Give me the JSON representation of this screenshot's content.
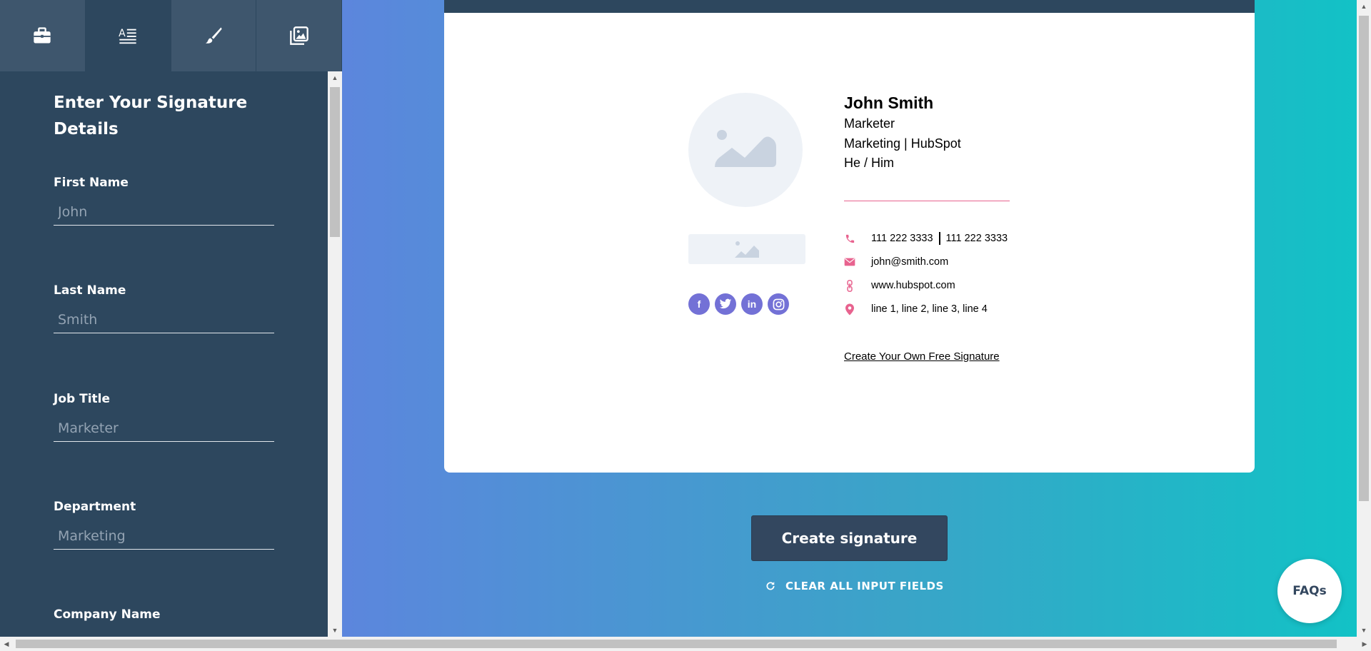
{
  "sidebar": {
    "tabs": [
      {
        "icon": "briefcase-icon"
      },
      {
        "icon": "text-format-icon"
      },
      {
        "icon": "brush-icon"
      },
      {
        "icon": "image-gallery-icon"
      }
    ],
    "form_title": "Enter Your Signature Details",
    "fields": [
      {
        "label": "First Name",
        "placeholder": "John"
      },
      {
        "label": "Last Name",
        "placeholder": "Smith"
      },
      {
        "label": "Job Title",
        "placeholder": "Marketer"
      },
      {
        "label": "Department",
        "placeholder": "Marketing"
      },
      {
        "label": "Company Name",
        "placeholder": ""
      }
    ]
  },
  "signature": {
    "name": "John Smith",
    "title": "Marketer",
    "department_company": "Marketing | HubSpot",
    "pronouns": "He / Him",
    "phone_1": "111 222 3333",
    "phone_2": "111 222 3333",
    "email": "john@smith.com",
    "website": "www.hubspot.com",
    "address": "line 1, line 2, line 3, line 4",
    "cta_link": "Create Your Own Free Signature",
    "social_icons": [
      "facebook-icon",
      "twitter-icon",
      "linkedin-icon",
      "instagram-icon"
    ],
    "accent_color": "#e8638f",
    "social_color": "#7371d6"
  },
  "actions": {
    "create_label": "Create signature",
    "clear_label": "CLEAR ALL INPUT FIELDS"
  },
  "faq_label": "FAQs",
  "colors": {
    "sidebar_bg": "#2d475e",
    "tab_bg": "#3e566d",
    "button_bg": "#33475f"
  }
}
